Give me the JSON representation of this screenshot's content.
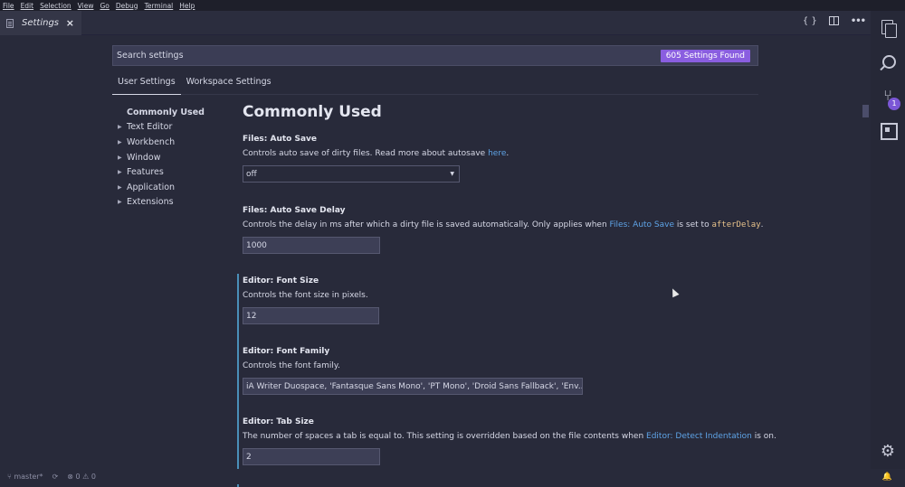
{
  "menubar": [
    "File",
    "Edit",
    "Selection",
    "View",
    "Go",
    "Debug",
    "Terminal",
    "Help"
  ],
  "tab": {
    "label": "Settings",
    "close": "×"
  },
  "title_actions": {
    "json": "{ }",
    "more": "•••"
  },
  "search": {
    "placeholder": "Search settings",
    "found": "605 Settings Found"
  },
  "settings_tabs": [
    "User Settings",
    "Workspace Settings"
  ],
  "toc": [
    {
      "label": "Commonly Used",
      "active": true
    },
    {
      "label": "Text Editor"
    },
    {
      "label": "Workbench"
    },
    {
      "label": "Window"
    },
    {
      "label": "Features"
    },
    {
      "label": "Application"
    },
    {
      "label": "Extensions"
    }
  ],
  "section_title": "Commonly Used",
  "settings": [
    {
      "title": "Files: Auto Save",
      "desc_pre": "Controls auto save of dirty files. Read more about autosave ",
      "link": "here",
      "desc_post": ".",
      "value": "off",
      "type": "select"
    },
    {
      "title": "Files: Auto Save Delay",
      "desc_pre": "Controls the delay in ms after which a dirty file is saved automatically. Only applies when ",
      "link": "Files: Auto Save",
      "desc_mid": " is set to ",
      "code": "afterDelay",
      "desc_post": ".",
      "value": "1000",
      "type": "text"
    },
    {
      "title": "Editor: Font Size",
      "desc": "Controls the font size in pixels.",
      "value": "12",
      "type": "text",
      "modified": true
    },
    {
      "title": "Editor: Font Family",
      "desc": "Controls the font family.",
      "value": "iA Writer Duospace, 'Fantasque Sans Mono', 'PT Mono', 'Droid Sans Fallback', 'Env...",
      "type": "text",
      "modified": true
    },
    {
      "title": "Editor: Tab Size",
      "desc_pre": "The number of spaces a tab is equal to. This setting is overridden based on the file contents when ",
      "link": "Editor: Detect Indentation",
      "desc_post": " is on.",
      "value": "2",
      "type": "text",
      "modified": true
    }
  ],
  "activity": {
    "scm_badge": "1"
  },
  "statusbar": {
    "branch": "master*",
    "errors": "0",
    "warnings": "0"
  },
  "colors": {
    "accent": "#8a5ee0",
    "link": "#5ea3e6",
    "modified_bar": "#4a8fb8",
    "background": "#282a3a"
  }
}
